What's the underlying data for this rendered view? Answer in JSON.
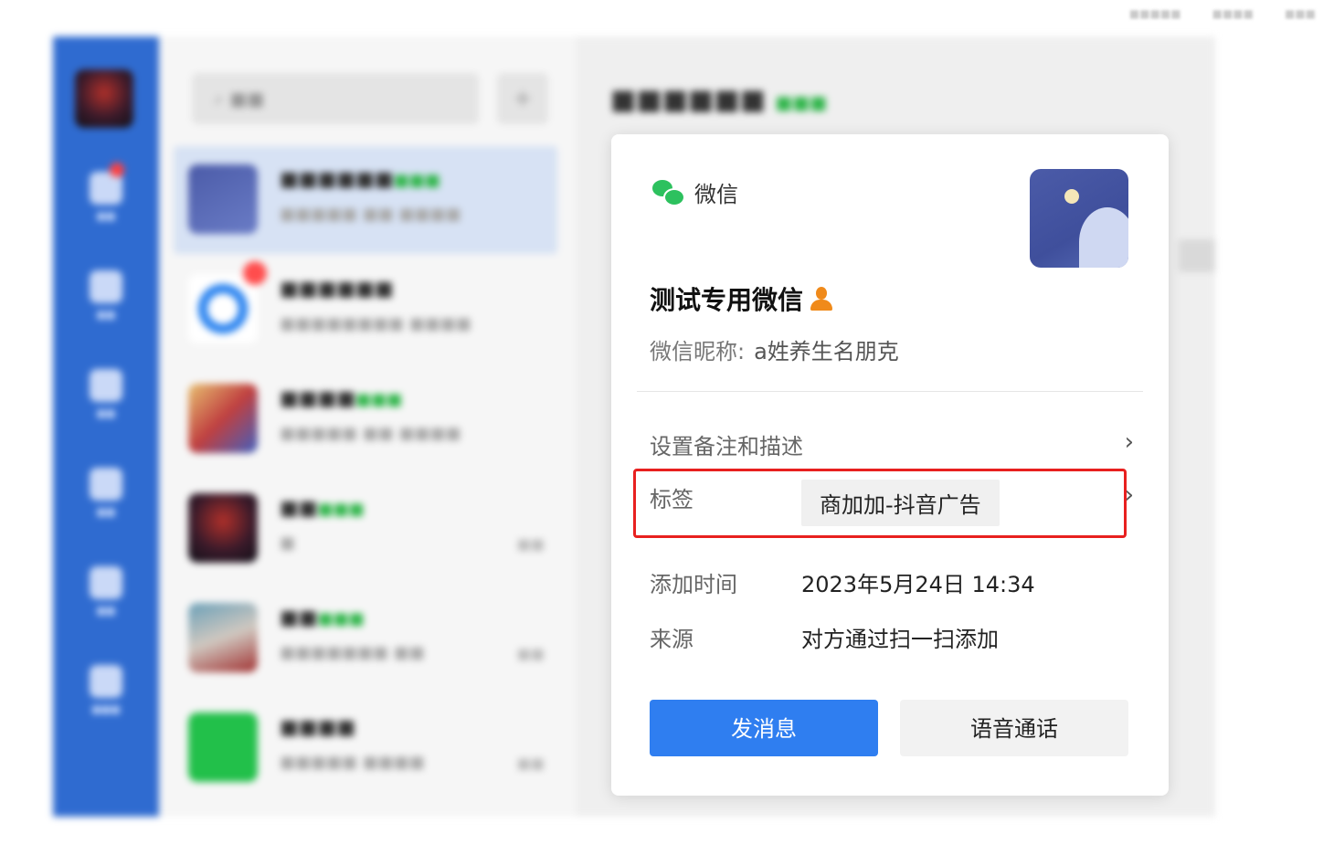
{
  "colors": {
    "rail": "#2f6bd0",
    "accent_blue": "#2f7ef0",
    "wechat_green": "#2dc15e",
    "highlight_red": "#e8201f",
    "person_orange": "#f08a1a"
  },
  "profile_card": {
    "app_label": "微信",
    "name": "测试专用微信",
    "nickname_label": "微信昵称:",
    "nickname_value": "a姓养生名朋克",
    "remark_label": "设置备注和描述",
    "tags_label": "标签",
    "tag_value": "商加加-抖音广告",
    "added_time_label": "添加时间",
    "added_time_value": "2023年5月24日 14:34",
    "source_label": "来源",
    "source_value": "对方通过扫一扫添加",
    "send_button": "发消息",
    "call_button": "语音通话"
  }
}
